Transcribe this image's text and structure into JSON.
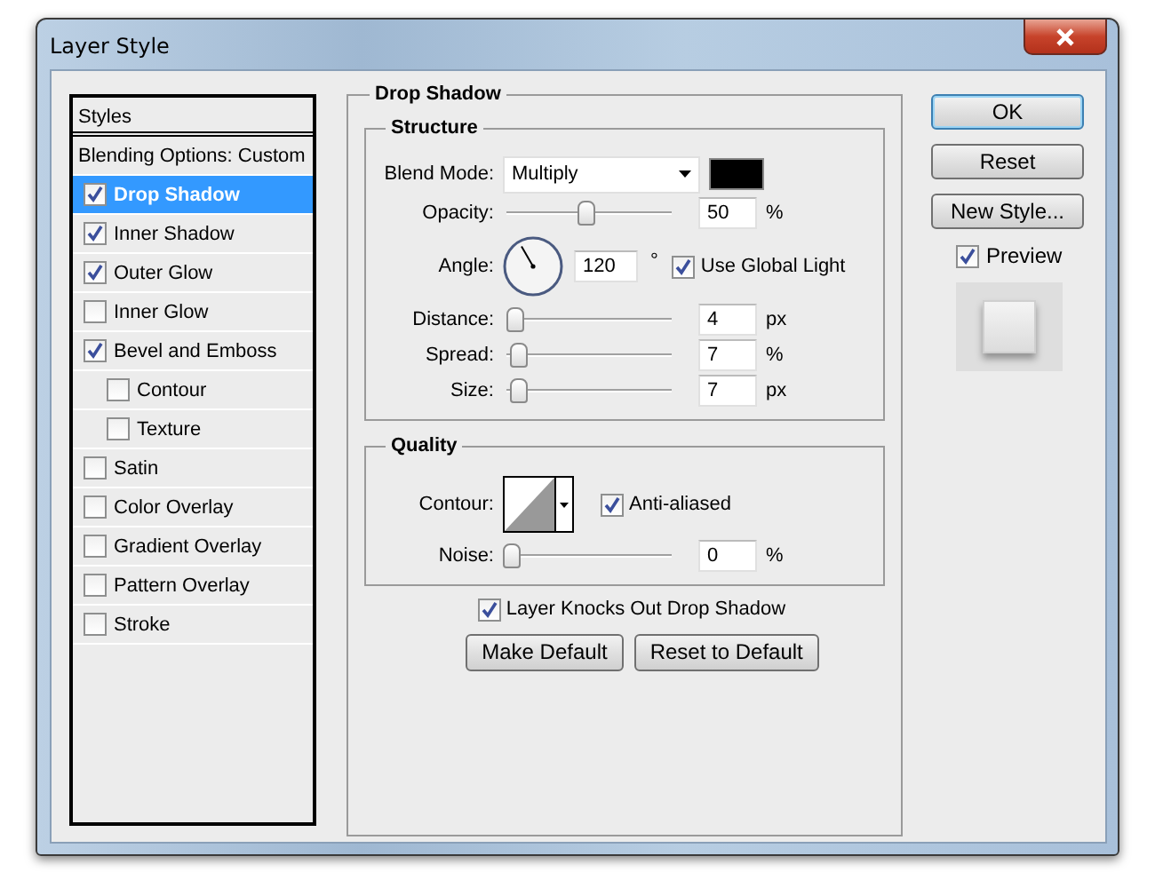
{
  "window": {
    "title": "Layer Style"
  },
  "styles_list": {
    "header": "Styles",
    "items": [
      {
        "kind": "plain",
        "label": "Blending Options: Custom",
        "selected": false
      },
      {
        "kind": "check",
        "label": "Drop Shadow",
        "checked": true,
        "selected": true
      },
      {
        "kind": "check",
        "label": "Inner Shadow",
        "checked": true,
        "selected": false
      },
      {
        "kind": "check",
        "label": "Outer Glow",
        "checked": true,
        "selected": false
      },
      {
        "kind": "check",
        "label": "Inner Glow",
        "checked": false,
        "selected": false
      },
      {
        "kind": "check",
        "label": "Bevel and Emboss",
        "checked": true,
        "selected": false,
        "children": [
          {
            "kind": "check",
            "label": "Contour",
            "checked": false,
            "selected": false
          },
          {
            "kind": "check",
            "label": "Texture",
            "checked": false,
            "selected": false
          }
        ]
      },
      {
        "kind": "check",
        "label": "Satin",
        "checked": false,
        "selected": false
      },
      {
        "kind": "check",
        "label": "Color Overlay",
        "checked": false,
        "selected": false
      },
      {
        "kind": "check",
        "label": "Gradient Overlay",
        "checked": false,
        "selected": false
      },
      {
        "kind": "check",
        "label": "Pattern Overlay",
        "checked": false,
        "selected": false
      },
      {
        "kind": "check",
        "label": "Stroke",
        "checked": false,
        "selected": false
      }
    ]
  },
  "drop_shadow": {
    "title": "Drop Shadow",
    "structure": {
      "title": "Structure",
      "blend_mode": {
        "label": "Blend Mode:",
        "value": "Multiply",
        "color": "#000000"
      },
      "opacity": {
        "label": "Opacity:",
        "level": 0.48,
        "value": "50",
        "unit": "%"
      },
      "angle": {
        "label": "Angle:",
        "value": "120",
        "unit": "°",
        "global_light": {
          "label": "Use Global Light",
          "checked": true
        }
      },
      "distance": {
        "label": "Distance:",
        "level": 0.02,
        "value": "4",
        "unit": "px"
      },
      "spread": {
        "label": "Spread:",
        "level": 0.05,
        "value": "7",
        "unit": "%"
      },
      "size": {
        "label": "Size:",
        "level": 0.05,
        "value": "7",
        "unit": "px"
      }
    },
    "quality": {
      "title": "Quality",
      "contour": {
        "label": "Contour:"
      },
      "anti_aliased": {
        "label": "Anti-aliased",
        "checked": true
      },
      "noise": {
        "label": "Noise:",
        "level": 0,
        "value": "0",
        "unit": "%"
      }
    },
    "knocks_out": {
      "label": "Layer Knocks Out Drop Shadow",
      "checked": true
    },
    "buttons": [
      "Make Default",
      "Reset to Default"
    ]
  },
  "side_buttons": [
    {
      "label": "OK",
      "default": true
    },
    {
      "label": "Reset",
      "default": false
    },
    {
      "label": "New Style...",
      "default": false
    }
  ],
  "preview": {
    "label": "Preview",
    "checked": true
  }
}
